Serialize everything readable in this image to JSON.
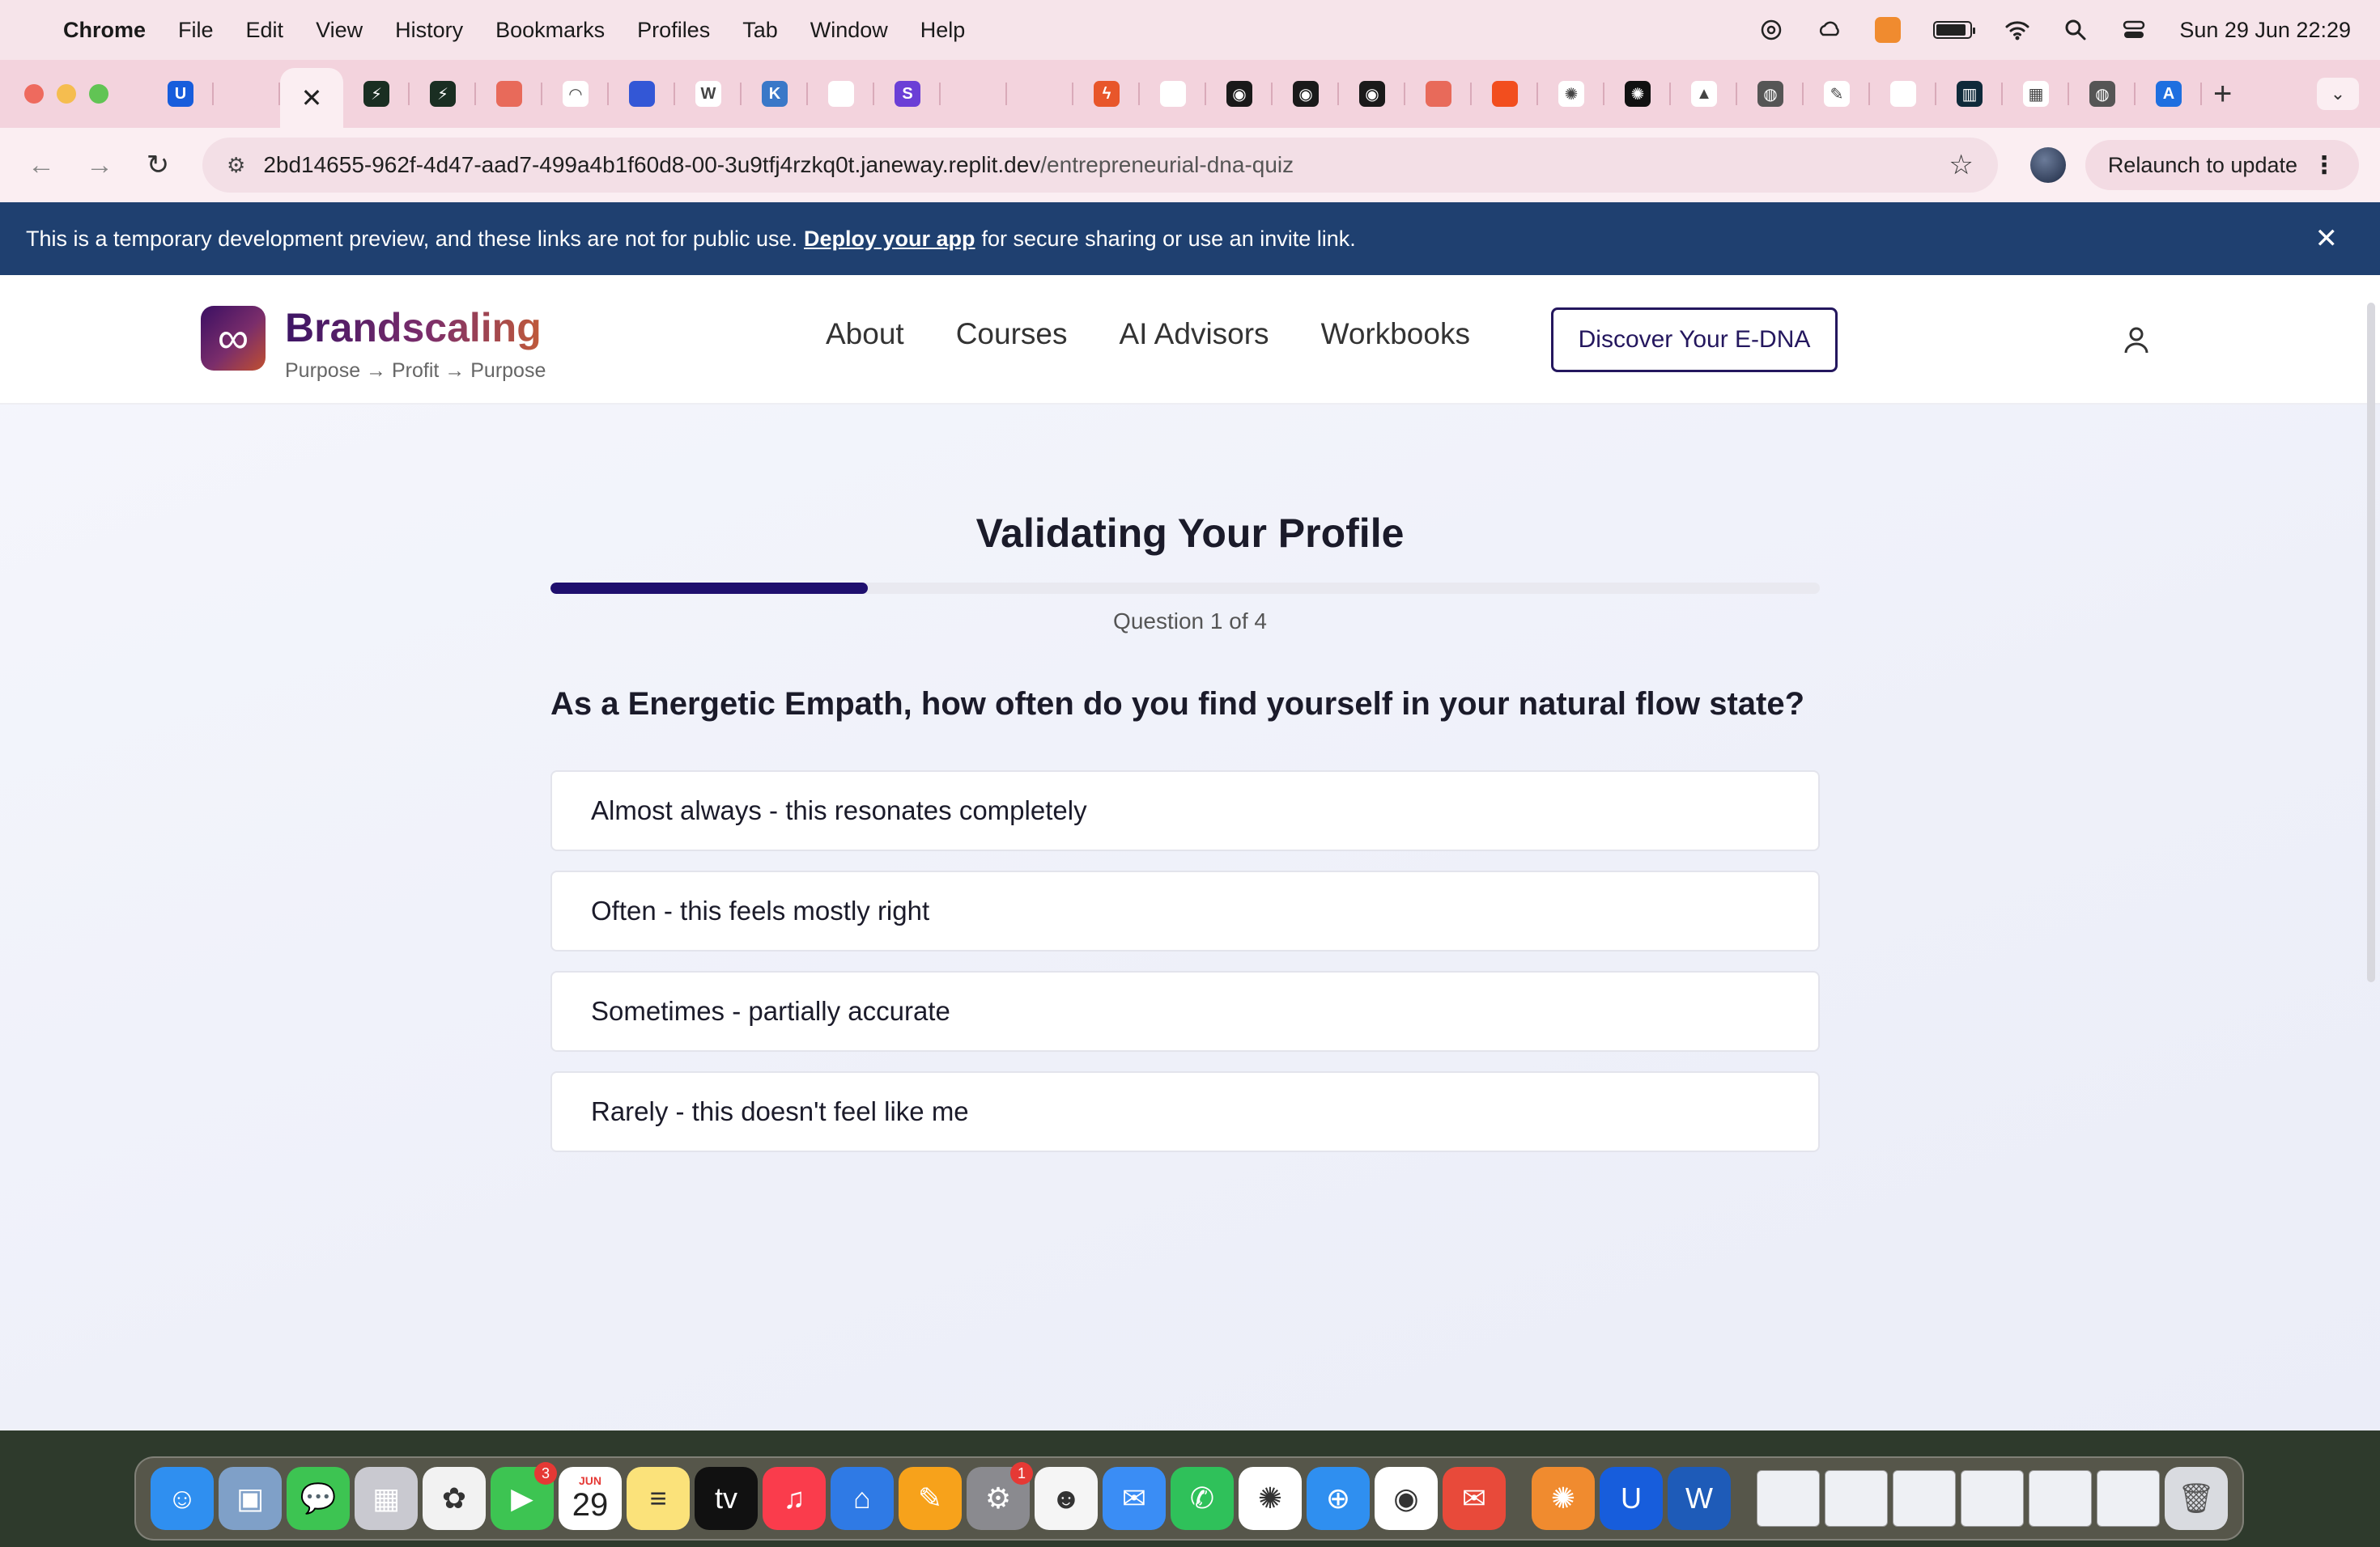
{
  "menubar": {
    "app": "Chrome",
    "items": [
      "File",
      "Edit",
      "View",
      "History",
      "Bookmarks",
      "Profiles",
      "Tab",
      "Window",
      "Help"
    ],
    "clock": "Sun 29 Jun  22:29"
  },
  "browser": {
    "url_host": "2bd14655-962f-4d47-aad7-499a4b1f60d8-00-3u9tfj4rzkq0t.janeway.replit.dev",
    "url_path": "/entrepreneurial-dna-quiz",
    "relaunch_label": "Relaunch to update",
    "tab_favicons": [
      {
        "icon": "bitwarden-icon",
        "color": "#175ddc",
        "glyph": "U"
      },
      {
        "icon": "puzzle-icon",
        "color": "#f3d3dd",
        "glyph": ""
      },
      {
        "icon": "close-icon",
        "color": "",
        "glyph": "✕"
      },
      {
        "icon": "bolt-icon",
        "color": "#1a2e22",
        "glyph": "⚡"
      },
      {
        "icon": "bolt-icon",
        "color": "#1a2e22",
        "glyph": "⚡"
      },
      {
        "icon": "cloud-icon",
        "color": "#e86a5a",
        "glyph": ""
      },
      {
        "icon": "chart-circle-icon",
        "color": "#ffffff",
        "glyph": "◠"
      },
      {
        "icon": "shape-icon",
        "color": "#3357d6",
        "glyph": ""
      },
      {
        "icon": "w-icon",
        "color": "#ffffff",
        "glyph": "W"
      },
      {
        "icon": "k-icon",
        "color": "#3a78c8",
        "glyph": "K"
      },
      {
        "icon": "doc-icon",
        "color": "#ffffff",
        "glyph": ""
      },
      {
        "icon": "s-icon",
        "color": "#6b3fd6",
        "glyph": "S"
      },
      {
        "icon": "blank-icon",
        "color": "",
        "glyph": ""
      },
      {
        "icon": "blank-icon",
        "color": "",
        "glyph": ""
      },
      {
        "icon": "bolt-icon",
        "color": "#e8562a",
        "glyph": "ϟ"
      },
      {
        "icon": "doc-icon",
        "color": "#ffffff",
        "glyph": ""
      },
      {
        "icon": "mask-icon",
        "color": "#1a1a1a",
        "glyph": "◉"
      },
      {
        "icon": "mask-icon",
        "color": "#1a1a1a",
        "glyph": "◉"
      },
      {
        "icon": "mask-icon",
        "color": "#1a1a1a",
        "glyph": "◉"
      },
      {
        "icon": "cloud-icon",
        "color": "#e86a5a",
        "glyph": ""
      },
      {
        "icon": "figma-icon",
        "color": "#f24e1e",
        "glyph": ""
      },
      {
        "icon": "openai-icon",
        "color": "#ffffff",
        "glyph": "✺"
      },
      {
        "icon": "openai-icon",
        "color": "#111111",
        "glyph": "✺"
      },
      {
        "icon": "drive-icon",
        "color": "#ffffff",
        "glyph": "▲"
      },
      {
        "icon": "globe-icon",
        "color": "#555555",
        "glyph": "◍"
      },
      {
        "icon": "pen-icon",
        "color": "#ffffff",
        "glyph": "✎"
      },
      {
        "icon": "doc-icon",
        "color": "#ffffff",
        "glyph": ""
      },
      {
        "icon": "bars-icon",
        "color": "#0f2a3a",
        "glyph": "▥"
      },
      {
        "icon": "table-icon",
        "color": "#ffffff",
        "glyph": "▦"
      },
      {
        "icon": "globe-icon",
        "color": "#555555",
        "glyph": "◍"
      },
      {
        "icon": "a-icon",
        "color": "#1e6fe0",
        "glyph": "A"
      }
    ]
  },
  "banner": {
    "text_before": "This is a temporary development preview, and these links are not for public use.",
    "link": "Deploy your app",
    "text_after": "for secure sharing or use an invite link."
  },
  "site": {
    "brand": "Brandscaling",
    "tagline": "Purpose → Profit → Purpose",
    "logo_glyph": "∞",
    "nav": [
      "About",
      "Courses",
      "AI Advisors",
      "Workbooks"
    ],
    "cta": "Discover Your E-DNA",
    "accent": "#24175e"
  },
  "quiz": {
    "title": "Validating Your Profile",
    "progress_fraction": 0.25,
    "counter": "Question 1 of 4",
    "question": "As a Energetic Empath, how often do you find yourself in your natural flow state?",
    "options": [
      "Almost always - this resonates completely",
      "Often - this feels mostly right",
      "Sometimes - partially accurate",
      "Rarely - this doesn't feel like me"
    ]
  },
  "dock": {
    "calendar_month": "JUN",
    "calendar_day": "29",
    "facetime_badge": "3",
    "settings_badge": "1",
    "apps": [
      {
        "name": "finder-icon",
        "color": "#2f8ff0",
        "glyph": "☺"
      },
      {
        "name": "preview-icon",
        "color": "#7fa0c8",
        "glyph": "▣"
      },
      {
        "name": "messages-icon",
        "color": "#3dc452",
        "glyph": "💬"
      },
      {
        "name": "launchpad-icon",
        "color": "#c9c9d0",
        "glyph": "▦"
      },
      {
        "name": "photos-icon",
        "color": "#f2f2f2",
        "glyph": "✿"
      },
      {
        "name": "facetime-icon",
        "color": "#3dc452",
        "glyph": "▶"
      },
      {
        "name": "calendar-icon",
        "color": "#ffffff",
        "glyph": ""
      },
      {
        "name": "notes-icon",
        "color": "#fbe27a",
        "glyph": "≡"
      },
      {
        "name": "appletv-icon",
        "color": "#111111",
        "glyph": "tv"
      },
      {
        "name": "music-icon",
        "color": "#fa3c4c",
        "glyph": "♫"
      },
      {
        "name": "keynote-icon",
        "color": "#2f7ae5",
        "glyph": "⌂"
      },
      {
        "name": "pages-icon",
        "color": "#f7a21b",
        "glyph": "✎"
      },
      {
        "name": "settings-icon",
        "color": "#8a8a8f",
        "glyph": "⚙"
      },
      {
        "name": "dog-icon",
        "color": "#f5f5f5",
        "glyph": "☻"
      },
      {
        "name": "mail-icon",
        "color": "#3a8df5",
        "glyph": "✉"
      },
      {
        "name": "whatsapp-icon",
        "color": "#2fc15a",
        "glyph": "✆"
      },
      {
        "name": "chatgpt-icon",
        "color": "#ffffff",
        "glyph": "✺"
      },
      {
        "name": "safari-icon",
        "color": "#2f8ff0",
        "glyph": "⊕"
      },
      {
        "name": "chrome-icon",
        "color": "#ffffff",
        "glyph": "◉"
      },
      {
        "name": "airmail-icon",
        "color": "#e84a3a",
        "glyph": "✉"
      },
      {
        "name": "claude-icon",
        "color": "#f08b2f",
        "glyph": "✺"
      },
      {
        "name": "bitwarden-icon",
        "color": "#175ddc",
        "glyph": "U"
      },
      {
        "name": "word-icon",
        "color": "#1e5bb8",
        "glyph": "W"
      }
    ]
  }
}
